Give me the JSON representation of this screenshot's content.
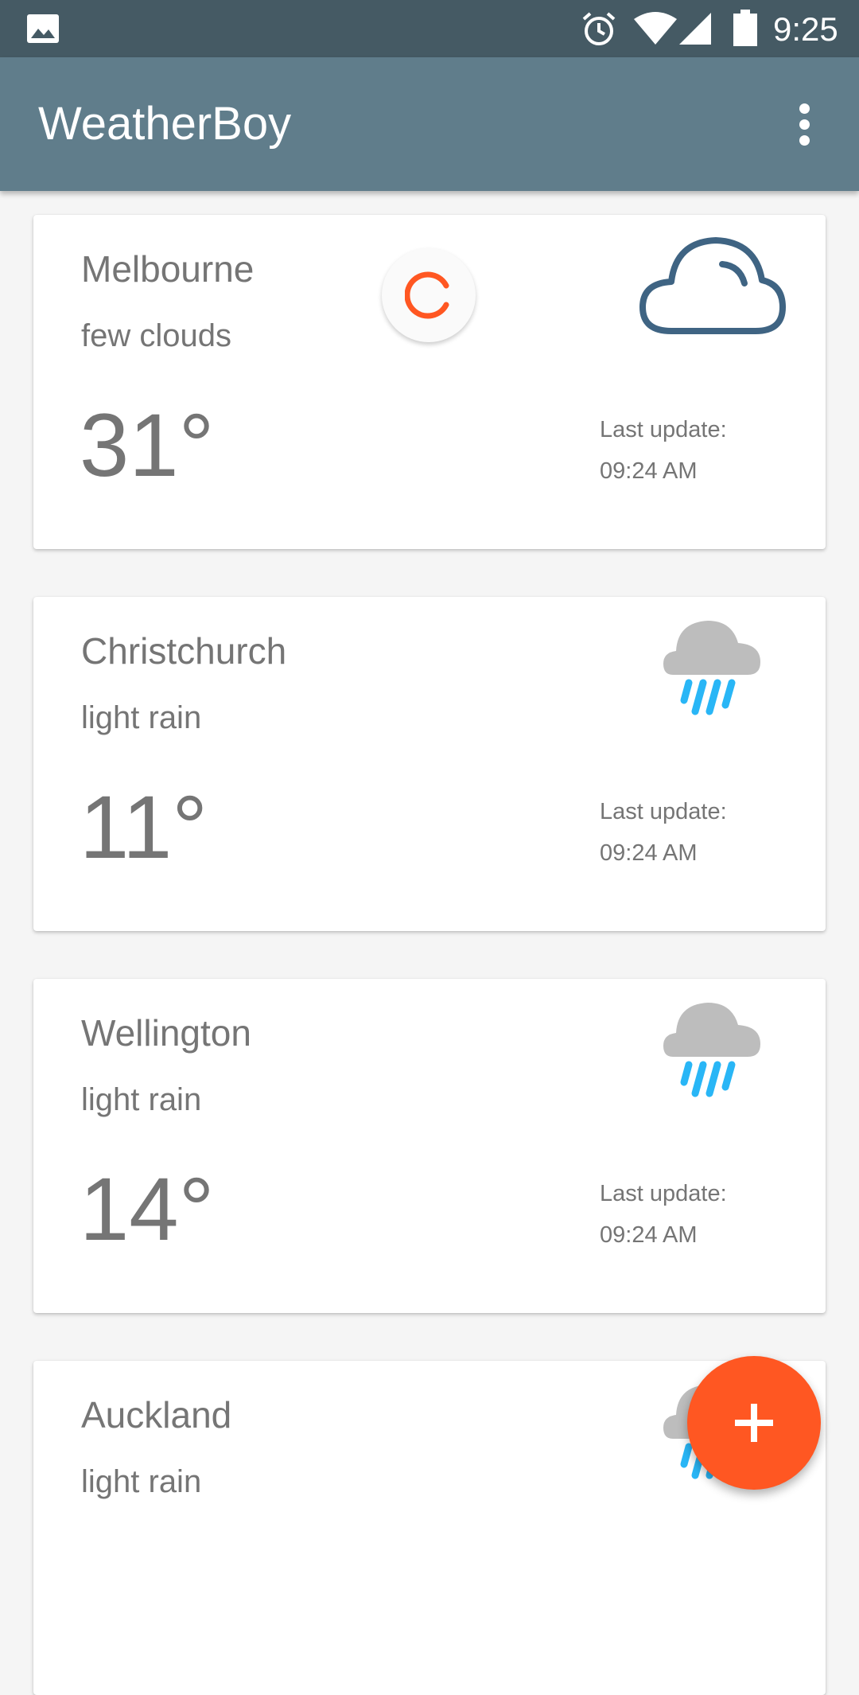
{
  "status_bar": {
    "time": "9:25"
  },
  "app_bar": {
    "title": "WeatherBoy"
  },
  "cards": [
    {
      "city": "Melbourne",
      "description": "few clouds",
      "temperature": "31°",
      "last_update_label": "Last update:",
      "last_update_time": "09:24 AM",
      "icon": "cloud-outline-icon"
    },
    {
      "city": "Christchurch",
      "description": "light rain",
      "temperature": "11°",
      "last_update_label": "Last update:",
      "last_update_time": "09:24 AM",
      "icon": "rain-cloud-icon"
    },
    {
      "city": "Wellington",
      "description": "light rain",
      "temperature": "14°",
      "last_update_label": "Last update:",
      "last_update_time": "09:24 AM",
      "icon": "rain-cloud-icon"
    },
    {
      "city": "Auckland",
      "description": "light rain",
      "temperature": "",
      "last_update_label": "",
      "last_update_time": "",
      "icon": "rain-cloud-icon"
    }
  ],
  "colors": {
    "app_bar": "#607d8b",
    "status_bar": "#455a64",
    "accent": "#ff5722",
    "rain": "#29b6f6"
  }
}
